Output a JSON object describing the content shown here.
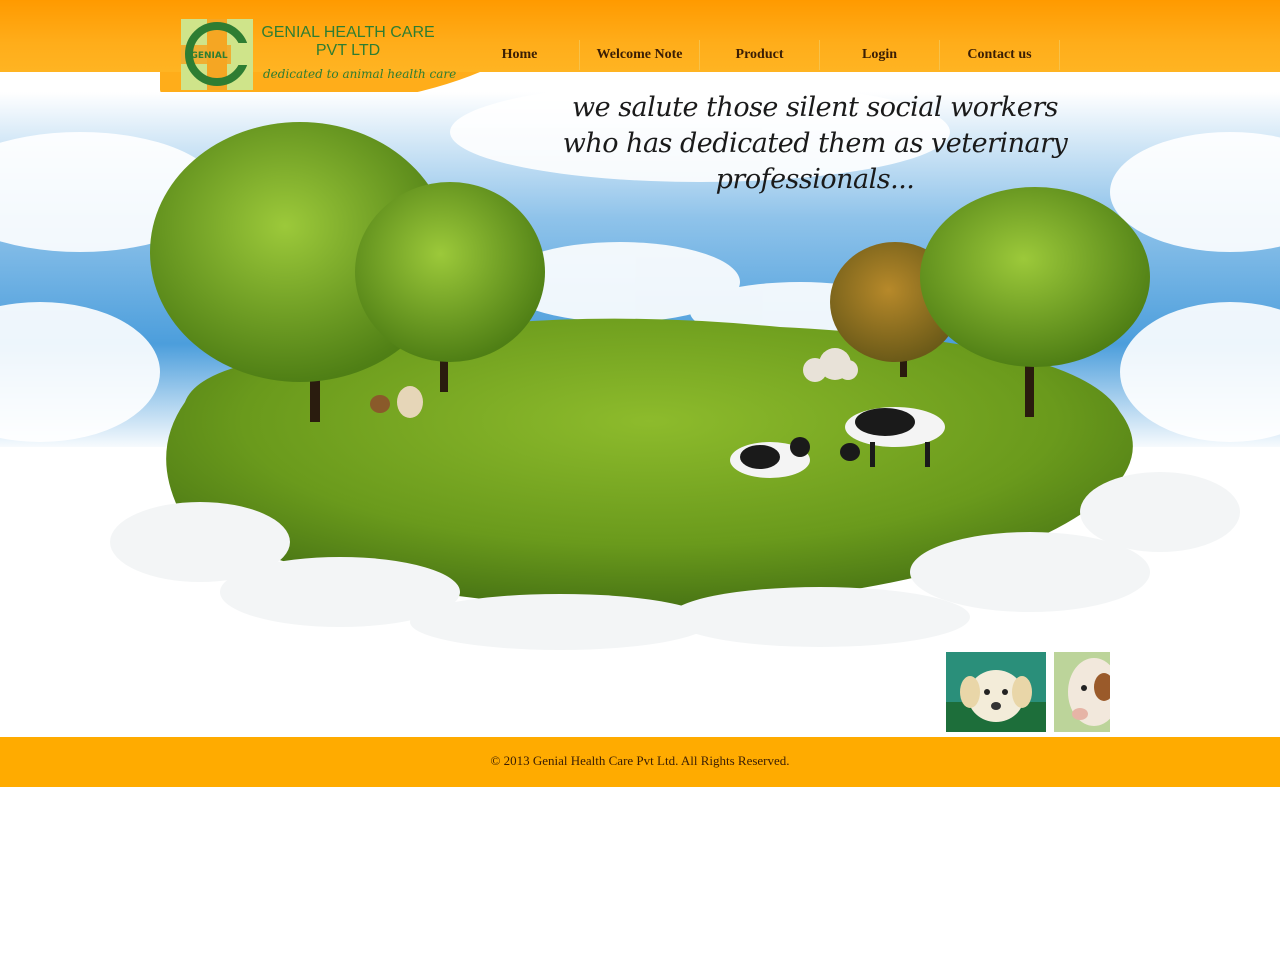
{
  "brand": {
    "name_line1": "GENIAL HEALTH CARE",
    "name_line2": "PVT LTD",
    "tagline": "dedicated to animal health care",
    "logo_text": "GENIAL"
  },
  "nav": {
    "items": [
      {
        "label": "Home"
      },
      {
        "label": "Welcome Note"
      },
      {
        "label": "Product"
      },
      {
        "label": "Login"
      },
      {
        "label": "Contact us"
      }
    ]
  },
  "hero": {
    "quote_line1": "we salute those silent social workers",
    "quote_line2": "who has dedicated them as veterinary professionals..."
  },
  "thumbnails": [
    {
      "icon": "puppy-photo"
    },
    {
      "icon": "calf-photo"
    }
  ],
  "footer": {
    "copyright": "© 2013 Genial Health Care Pvt Ltd. All Rights Reserved."
  },
  "colors": {
    "header_orange": "#ff9a00",
    "footer_orange": "#ffab00",
    "brand_green": "#2e7d32",
    "nav_text": "#3a1e05"
  }
}
